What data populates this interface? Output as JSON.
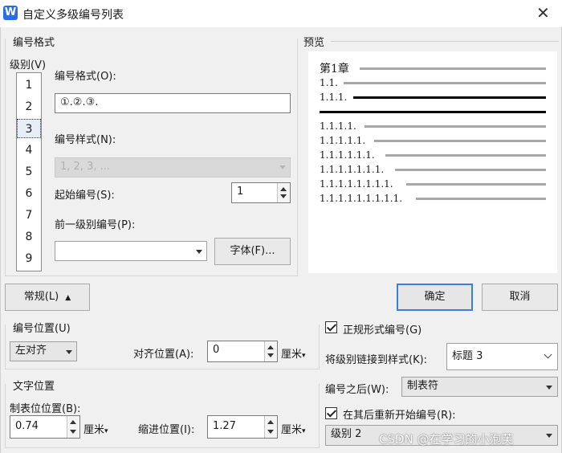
{
  "window": {
    "title": "自定义多级编号列表",
    "app_icon": "W",
    "close_icon": "close-icon"
  },
  "format_group": {
    "label": "编号格式",
    "level_label": "级别(V)",
    "levels": [
      "1",
      "2",
      "3",
      "4",
      "5",
      "6",
      "7",
      "8",
      "9"
    ],
    "selected_level": "3",
    "number_format_label": "编号格式(O):",
    "number_format_value": "①.②.③.",
    "number_style_label": "编号样式(N):",
    "number_style_value": "1, 2, 3, ...",
    "start_at_label": "起始编号(S):",
    "start_at_value": "1",
    "prev_level_label": "前一级别编号(P):",
    "prev_level_value": "",
    "font_button": "字体(F)..."
  },
  "preview": {
    "label": "预览",
    "rows": [
      "第1章",
      "1.1.",
      "1.1.1.",
      "1.1.1.1.",
      "1.1.1.1.1.",
      "1.1.1.1.1.1.",
      "1.1.1.1.1.1.1.",
      "1.1.1.1.1.1.1.1.",
      "1.1.1.1.1.1.1.1.1."
    ]
  },
  "buttons": {
    "normal": "常规(L)",
    "ok": "确定",
    "cancel": "取消"
  },
  "number_position": {
    "label": "编号位置(U)",
    "alignment_value": "左对齐",
    "align_at_label": "对齐位置(A):",
    "align_at_value": "0",
    "unit": "厘米"
  },
  "text_position": {
    "label": "文字位置",
    "tab_stop_label": "制表位位置(B):",
    "tab_stop_value": "0.74",
    "indent_label": "缩进位置(I):",
    "indent_value": "1.27",
    "unit": "厘米"
  },
  "right_options": {
    "legal_style_label": "正规形式编号(G)",
    "legal_style_checked": true,
    "link_style_label": "将级别链接到样式(K):",
    "link_style_value": "标题 3",
    "follow_number_label": "编号之后(W):",
    "follow_number_value": "制表符",
    "restart_label": "在其后重新开始编号(R):",
    "restart_checked": true,
    "restart_value": "级别 2"
  },
  "watermark": "CSDN @在学习的小泡芙"
}
